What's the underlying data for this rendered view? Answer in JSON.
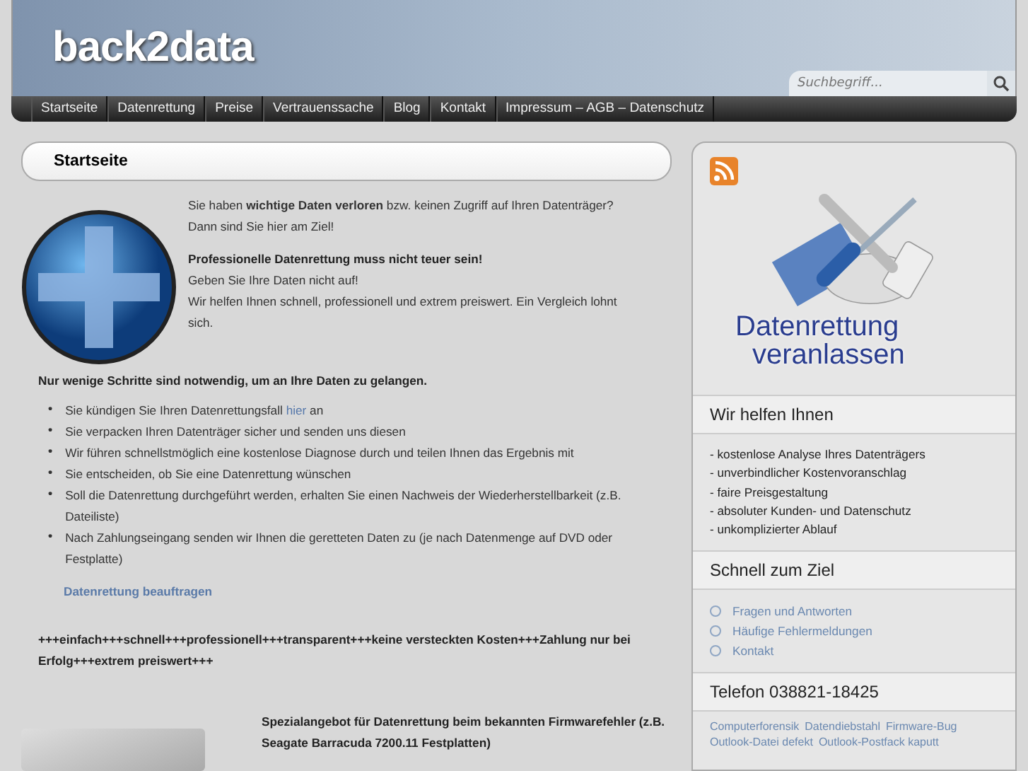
{
  "header": {
    "logo": "back2data",
    "search": {
      "placeholder": "Suchbegriff..."
    }
  },
  "nav": [
    {
      "label": "Startseite"
    },
    {
      "label": "Datenrettung"
    },
    {
      "label": "Preise"
    },
    {
      "label": "Vertrauenssache"
    },
    {
      "label": "Blog"
    },
    {
      "label": "Kontakt"
    },
    {
      "label": "Impressum – AGB – Datenschutz"
    }
  ],
  "main": {
    "title": "Startseite",
    "intro": [
      "Sie haben **wichtige Daten verloren** bzw. keinen Zugriff auf Ihren Datenträger?",
      "Dann sind Sie hier am Ziel!"
    ],
    "claim": "Professionelle Datenrettung muss nicht teuer sein!",
    "claim_text": [
      "Geben Sie Ihre Daten nicht auf!",
      "Wir helfen Ihnen schnell, professionell und extrem preiswert. Ein Vergleich lohnt sich."
    ],
    "steps_heading": "Nur wenige Schritte sind notwendig, um an Ihre Daten zu gelangen.",
    "steps": [
      {
        "marker": "•",
        "before": "Sie kündigen Sie Ihren Datenrettungsfall ",
        "link": "hier",
        "after": " an"
      },
      {
        "marker": "•",
        "before": "Sie verpacken Ihren Datenträger sicher und senden uns diesen"
      },
      {
        "marker": "•",
        "before": "Wir führen schnellstmöglich eine kostenlose Diagnose durch und teilen Ihnen das Ergebnis mit"
      },
      {
        "marker": "•",
        "before": "Sie entscheiden, ob Sie eine Datenrettung wünschen"
      },
      {
        "marker": "•",
        "before": "Soll die Datenrettung durchgeführt werden, erhalten Sie einen Nachweis der Wiederherstellbarkeit (z.B. Dateiliste)"
      },
      {
        "marker": "•",
        "before": "Nach Zahlungseingang senden wir Ihnen die geretteten Daten zu (je nach Datenmenge auf DVD oder Festplatte)"
      }
    ],
    "order_link": "Datenrettung beauftragen",
    "slogan": "+++einfach+++schnell+++professionell+++transparent+++keine versteckten Kosten+++Zahlung nur bei Erfolg+++extrem preiswert+++",
    "offer": "Spezialangebot für Datenrettung beim bekannten Firmwarefehler (z.B. Seagate Barracuda 7200.11 Festplatten)"
  },
  "sidebar": {
    "banner": [
      "Datenrettung",
      "veranlassen"
    ],
    "help": {
      "title": "Wir helfen Ihnen",
      "items": [
        "- kostenlose Analyse Ihres Datenträgers",
        "- unverbindlicher Kostenvoranschlag",
        "- faire Preisgestaltung",
        "- absoluter Kunden- und Datenschutz",
        "- unkomplizierter Ablauf"
      ]
    },
    "quick": {
      "title": "Schnell zum Ziel",
      "links": [
        "Fragen und Antworten",
        "Häufige Fehlermeldungen",
        "Kontakt"
      ]
    },
    "phone": "Telefon 038821-18425",
    "tags": [
      "Computerforensik",
      "Datendiebstahl",
      "Firmware-Bug",
      "Outlook-Datei defekt",
      "Outlook-Postfack kaputt"
    ]
  }
}
